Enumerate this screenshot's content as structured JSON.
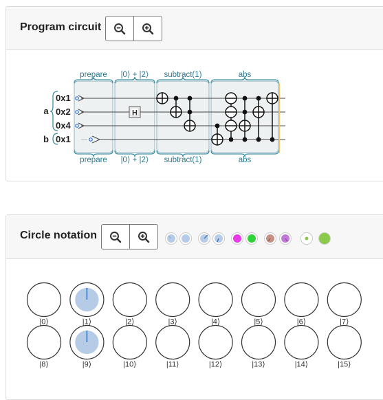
{
  "program_circuit": {
    "title": "Program circuit",
    "zoom_out_icon": "zoom-out-icon",
    "zoom_in_icon": "zoom-in-icon",
    "stage_labels": [
      "prepare",
      "|0⟩ + |2⟩",
      "subtract(1)",
      "abs"
    ],
    "registers": [
      {
        "name": "a",
        "qubits": [
          "0x1",
          "0x2",
          "0x4"
        ]
      },
      {
        "name": "b",
        "qubits": [
          "0x1"
        ]
      }
    ],
    "hadamard_label": "H"
  },
  "circle_notation": {
    "title": "Circle notation",
    "zoom_out_icon": "zoom-out-icon",
    "zoom_in_icon": "zoom-in-icon",
    "colors": {
      "amplitude_fill": "#b6cbe6",
      "phase_line": "#2f6fb5",
      "swatch_magenta": "#e83ae6",
      "swatch_green": "#2fd338",
      "swatch_brown": "#c49184",
      "swatch_purple": "#c07ad6",
      "swatch_large_green": "#8ac94a"
    },
    "states": [
      {
        "label": "|0⟩",
        "magnitude": 0,
        "phase_deg": 0
      },
      {
        "label": "|1⟩",
        "magnitude": 0.707,
        "phase_deg": 0
      },
      {
        "label": "|2⟩",
        "magnitude": 0,
        "phase_deg": 0
      },
      {
        "label": "|3⟩",
        "magnitude": 0,
        "phase_deg": 0
      },
      {
        "label": "|4⟩",
        "magnitude": 0,
        "phase_deg": 0
      },
      {
        "label": "|5⟩",
        "magnitude": 0,
        "phase_deg": 0
      },
      {
        "label": "|6⟩",
        "magnitude": 0,
        "phase_deg": 0
      },
      {
        "label": "|7⟩",
        "magnitude": 0,
        "phase_deg": 0
      },
      {
        "label": "|8⟩",
        "magnitude": 0,
        "phase_deg": 0
      },
      {
        "label": "|9⟩",
        "magnitude": 0.707,
        "phase_deg": 0
      },
      {
        "label": "|10⟩",
        "magnitude": 0,
        "phase_deg": 0
      },
      {
        "label": "|11⟩",
        "magnitude": 0,
        "phase_deg": 0
      },
      {
        "label": "|12⟩",
        "magnitude": 0,
        "phase_deg": 0
      },
      {
        "label": "|13⟩",
        "magnitude": 0,
        "phase_deg": 0
      },
      {
        "label": "|14⟩",
        "magnitude": 0,
        "phase_deg": 0
      },
      {
        "label": "|15⟩",
        "magnitude": 0,
        "phase_deg": 0
      }
    ]
  }
}
